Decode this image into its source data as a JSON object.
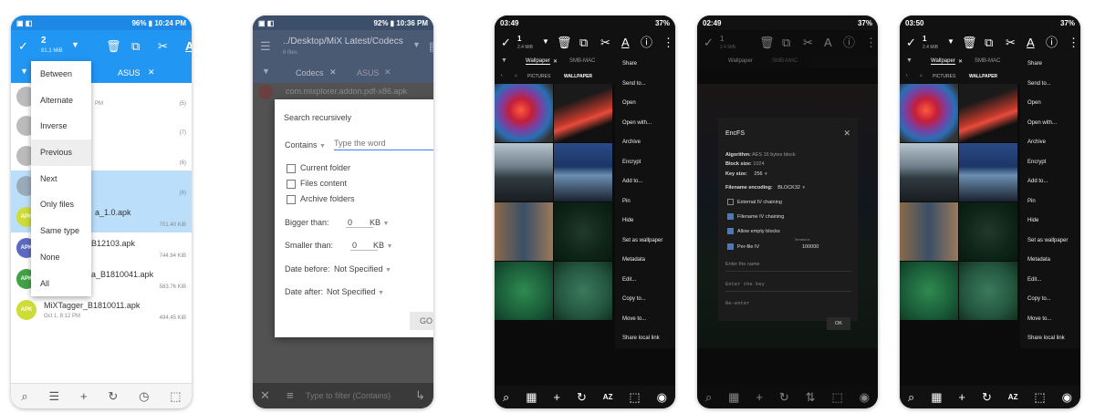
{
  "p1": {
    "status": {
      "time": "10:24 PM",
      "battery": "96%"
    },
    "toolbar": {
      "count": "2",
      "size": "81.1 MiB"
    },
    "tabs": [
      "ASUS"
    ],
    "menu": [
      "Between",
      "Alternate",
      "Inverse",
      "Previous",
      "Next",
      "Only files",
      "Same type",
      "None",
      "All"
    ],
    "rows": [
      {
        "name": "",
        "meta": "",
        "right": "(5)",
        "sub": "PM"
      },
      {
        "name": "",
        "meta": "",
        "right": "(7)",
        "sub": ""
      },
      {
        "name": "",
        "meta": "",
        "right": "(6)",
        "sub": ""
      },
      {
        "name": "",
        "meta": "",
        "right": "(6)",
        "sub": ""
      },
      {
        "name": "a_1.0.apk",
        "meta": "",
        "right": "701.40 KiB",
        "sub": ""
      },
      {
        "name": "B12103.apk",
        "meta": "",
        "right": "744.94 KiB",
        "sub": ""
      },
      {
        "name": "a_B1810041.apk",
        "meta": "",
        "right": "583.76 KiB",
        "sub": ""
      },
      {
        "name": "MiXTagger_B1810011.apk",
        "meta": "Oct 1, 8:12 PM",
        "right": "494.45 KiB",
        "sub": ""
      }
    ],
    "colors": {
      "accent": "#2196F3",
      "selected": "#BBDEFB"
    }
  },
  "p2": {
    "status": {
      "time": "10:36 PM",
      "battery": "92%"
    },
    "toolbar": {
      "path": "../Desktop/MiX Latest/Codecs",
      "files": "6 files"
    },
    "tabs": [
      "Codecs",
      "ASUS"
    ],
    "row0": "com.mixplorer.addon.pdf-x86.apk",
    "dialog": {
      "title": "Search recursively",
      "mode": "Contains",
      "placeholder": "Type the word",
      "checks": [
        "Current folder",
        "Files content",
        "Archive folders"
      ],
      "bigger": "Bigger than:",
      "bigger_val": "0",
      "bigger_unit": "KB",
      "smaller": "Smaller than:",
      "smaller_val": "0",
      "smaller_unit": "KB",
      "before": "Date before:",
      "before_val": "Not Specified",
      "after": "Date after:",
      "after_val": "Not Specified",
      "go": "GO"
    },
    "filter_placeholder": "Type to filter (Contains)"
  },
  "p3": {
    "status": {
      "time": "03:49",
      "battery": "37%"
    },
    "toolbar": {
      "count": "1",
      "size": "2.4 MiB"
    },
    "tabs": [
      "Wallpaper",
      "SMB-MAC"
    ],
    "crumb": [
      "PICTURES",
      "WALLPAPER"
    ],
    "menu": [
      "Share",
      "Send to...",
      "Open",
      "Open with...",
      "Archive",
      "Encrypt",
      "Add to...",
      "Pin",
      "Hide",
      "Set as wallpaper",
      "Metadata",
      "Edit...",
      "Copy to...",
      "Move to...",
      "Share local link"
    ]
  },
  "p4": {
    "status": {
      "time": "02:49",
      "battery": "37%"
    },
    "toolbar": {
      "count": "1",
      "size": "2.4 MiB"
    },
    "tabs": [
      "Wallpaper",
      "SMB-MAC"
    ],
    "dialog": {
      "title": "EncFS",
      "algo_l": "Algorithm:",
      "algo": "AES 16 bytes block",
      "bs_l": "Block size:",
      "bs": "1024",
      "ks_l": "Key size:",
      "ks": "256",
      "fe_l": "Filename encoding:",
      "fe": "BLOCK32",
      "checks": [
        "External IV chaining",
        "Filename IV chaining",
        "Allow empty blocks",
        "Per-file IV"
      ],
      "iter_l": "Iterations",
      "iter": "100000",
      "name_ph": "Enter the name",
      "key_ph": "Enter the key",
      "re_ph": "Re-enter",
      "ok": "OK"
    }
  },
  "p5": {
    "status": {
      "time": "03:50",
      "battery": "37%"
    },
    "toolbar": {
      "count": "1",
      "size": "2.4 MiB"
    },
    "tabs": [
      "Wallpaper",
      "SMB-MAC"
    ],
    "crumb": [
      "PICTURES",
      "WALLPAPER"
    ],
    "menu": [
      "Share",
      "Send to...",
      "Open",
      "Open with...",
      "Archive",
      "Encrypt",
      "Add to...",
      "Pin",
      "Hide",
      "Set as wallpaper",
      "Metadata",
      "Edit...",
      "Copy to...",
      "Move to...",
      "Share local link"
    ],
    "az": "AZ"
  }
}
